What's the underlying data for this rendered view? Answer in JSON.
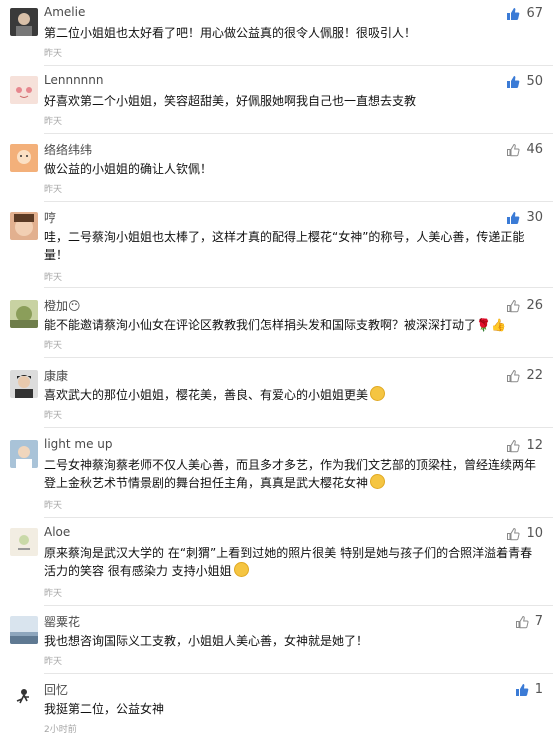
{
  "comments": [
    {
      "user": "Amelie",
      "text": "第二位小姐姐也太好看了吧！用心做公益真的很令人佩服！很吸引人！",
      "time": "昨天",
      "likes": "67",
      "liked": true,
      "avatar_color": "#3a3a3a"
    },
    {
      "user": "Lennnnnn",
      "text": "好喜欢第二个小姐姐，笑容超甜美，好佩服她啊我自己也一直想去支教",
      "time": "昨天",
      "likes": "50",
      "liked": true,
      "avatar_color": "#f3d7d0"
    },
    {
      "user": "络络纬纬",
      "text": "做公益的小姐姐的确让人钦佩！",
      "time": "昨天",
      "likes": "46",
      "liked": false,
      "avatar_color": "#f0a468"
    },
    {
      "user": "哼",
      "text": "哇，二号蔡洵小姐姐也太棒了，这样才真的配得上樱花“女神”的称号，人美心善，传递正能量！",
      "time": "昨天",
      "likes": "30",
      "liked": true,
      "avatar_color": "#c2704a"
    },
    {
      "user": "橙加😶",
      "text": "能不能邀请蔡洵小仙女在评论区教教我们怎样捐头发和国际支教啊？被深深打动了🌹👍",
      "time": "昨天",
      "likes": "26",
      "liked": false,
      "avatar_color": "#9bab6e"
    },
    {
      "user": "康康",
      "text": "喜欢武大的那位小姐姐，樱花美，善良、有爱心的小姐姐更美",
      "time": "昨天",
      "likes": "22",
      "liked": false,
      "avatar_color": "#5a5a5a"
    },
    {
      "user": "light me up",
      "text": "二号女神蔡洵蔡老师不仅人美心善，而且多才多艺，作为我们文艺部的顶梁柱，曾经连续两年登上金秋艺术节情景剧的舞台担任主角，真真是武大樱花女神",
      "time": "昨天",
      "likes": "12",
      "liked": false,
      "avatar_color": "#8fb0c9"
    },
    {
      "user": "Aloe",
      "text": "原来蔡洵是武汉大学的 在“刺猬”上看到过她的照片很美 特别是她与孩子们的合照洋溢着青春活力的笑容 很有感染力 支持小姐姐",
      "time": "昨天",
      "likes": "10",
      "liked": false,
      "avatar_color": "#efeae0"
    },
    {
      "user": "罂粟花",
      "text": "我也想咨询国际义工支教，小姐姐人美心善，女神就是她了！",
      "time": "昨天",
      "likes": "7",
      "liked": false,
      "avatar_color": "#b7c8d6"
    },
    {
      "user": "回忆",
      "text": "我挺第二位，公益女神",
      "time": "2小时前",
      "likes": "1",
      "liked": true,
      "avatar_color": "#ffffff"
    }
  ],
  "colors": {
    "like_active": "#3b7bd6",
    "like_idle": "#8a8a8a"
  }
}
